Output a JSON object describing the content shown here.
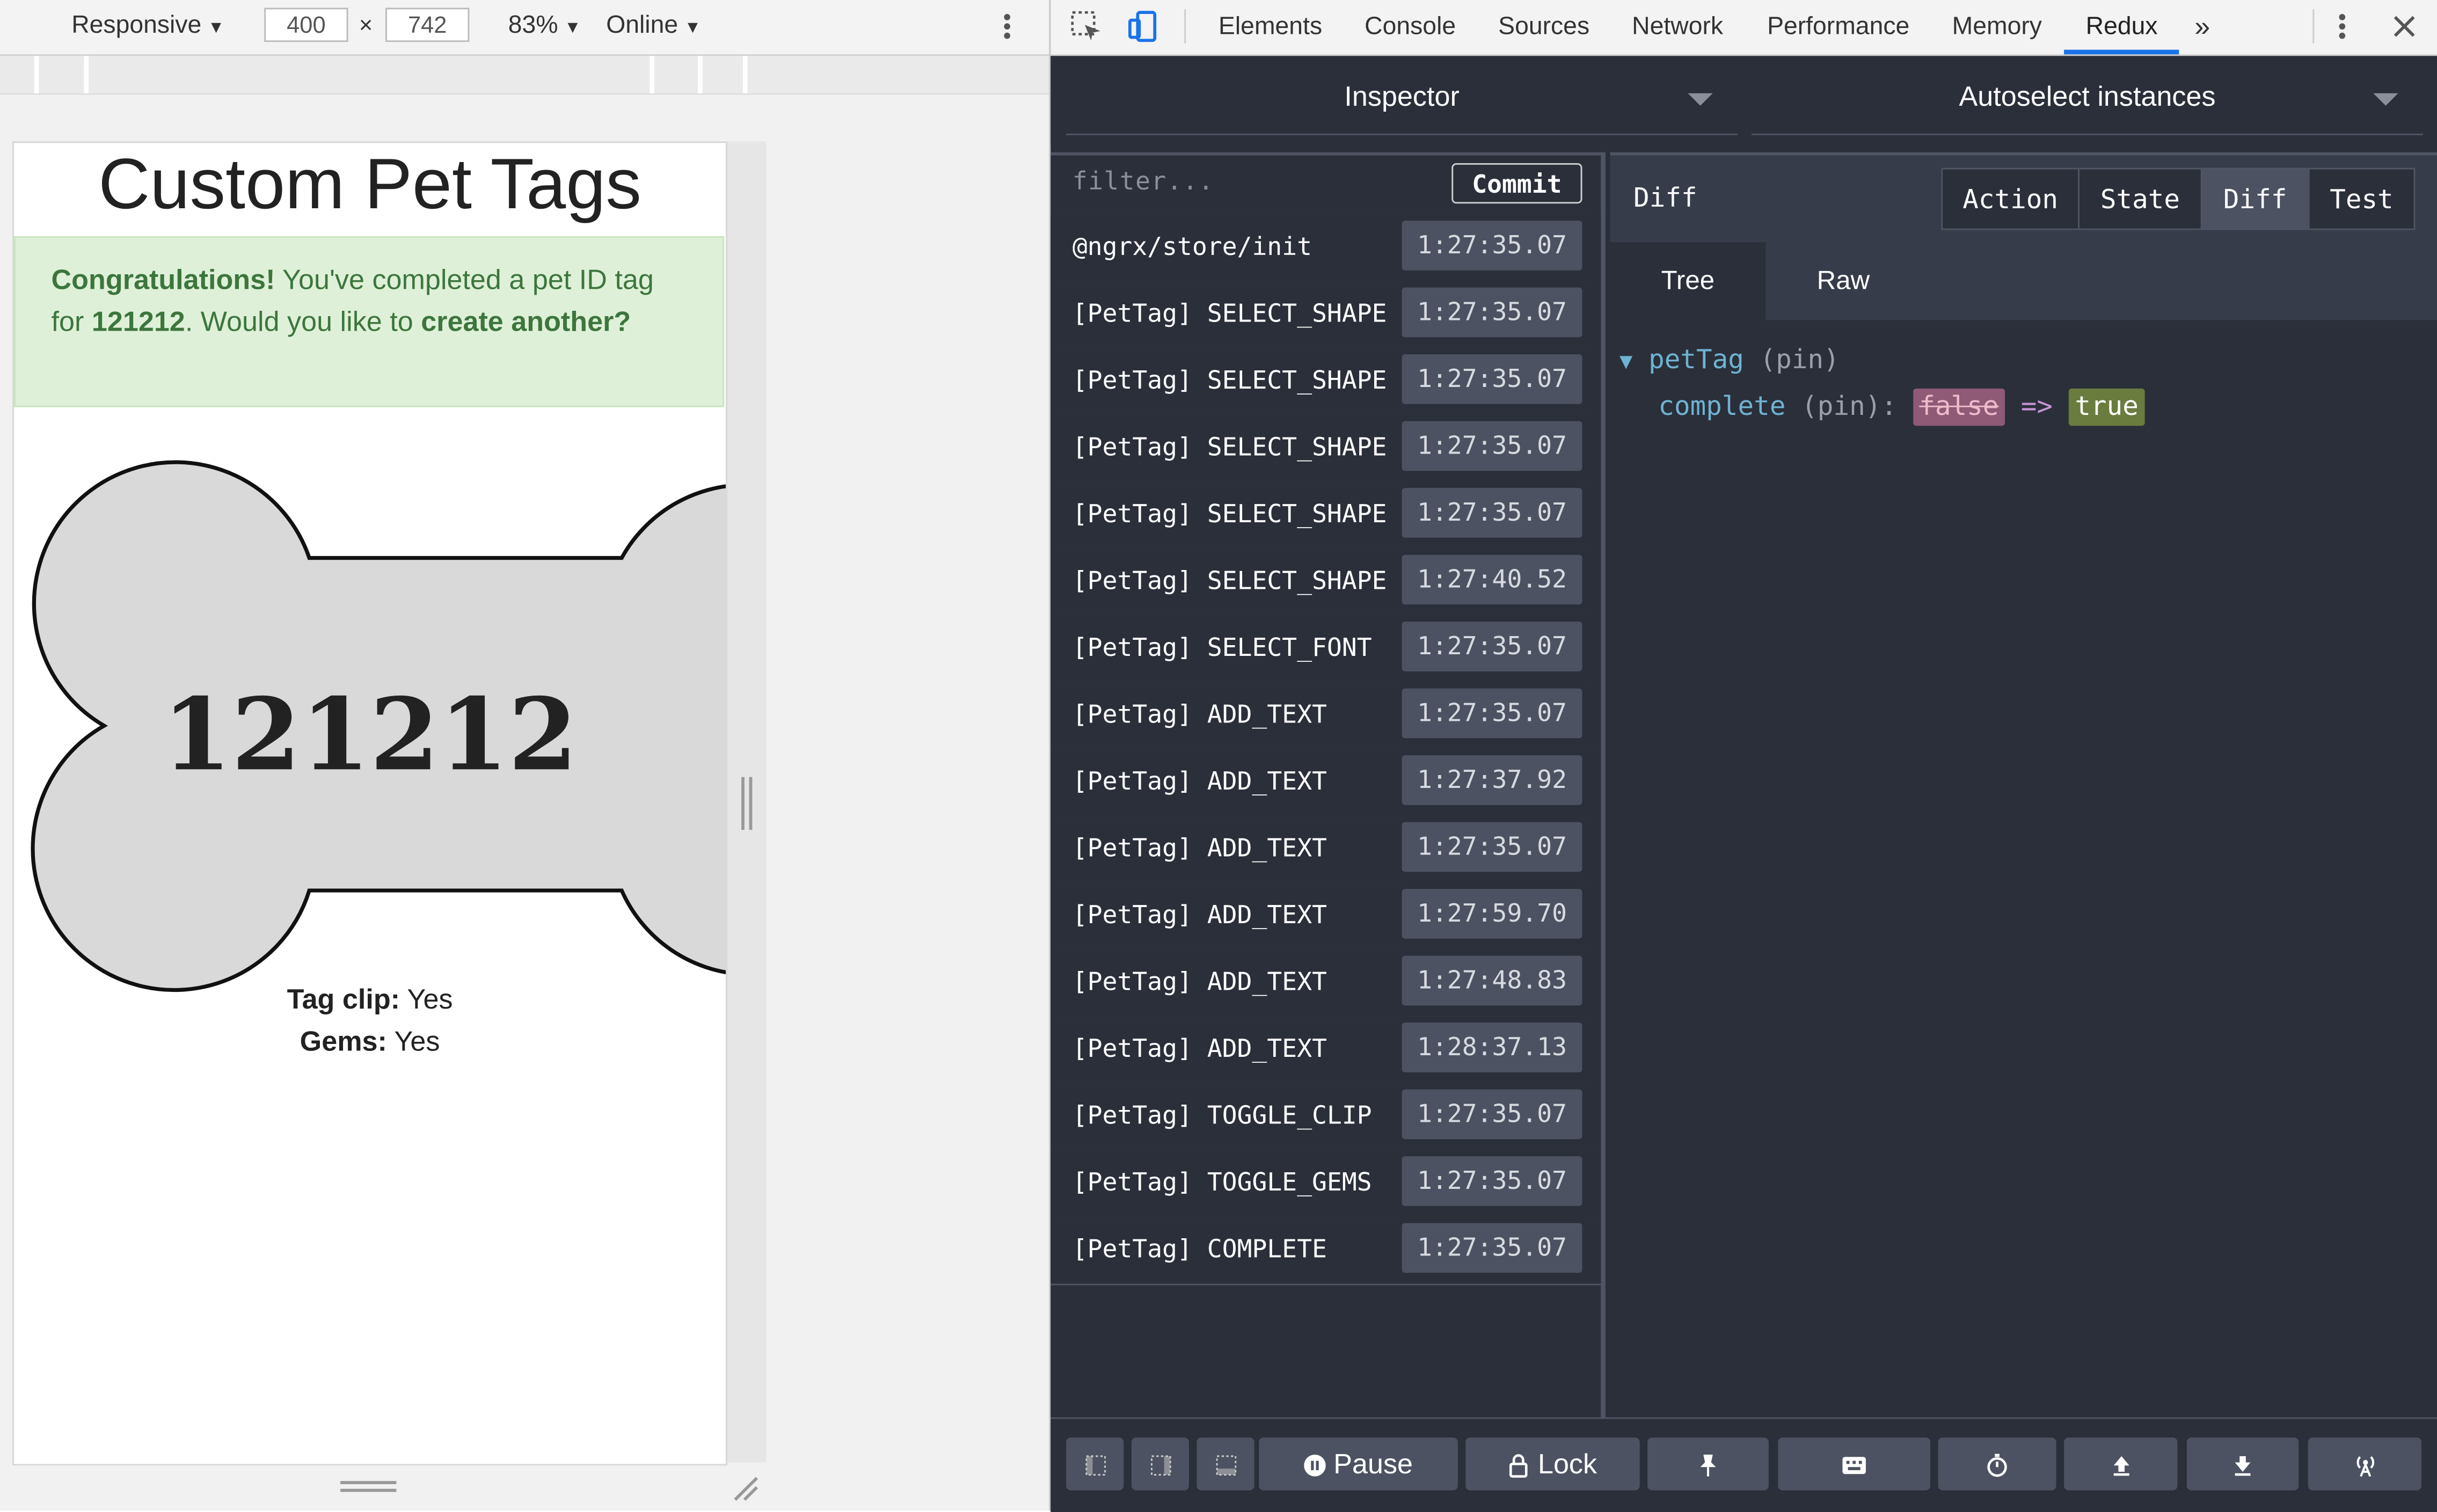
{
  "device_toolbar": {
    "mode": "Responsive",
    "width": "400",
    "times": "×",
    "height": "742",
    "zoom": "83%",
    "network": "Online"
  },
  "page": {
    "title": "Custom Pet Tags",
    "alert": {
      "strong": "Congratulations!",
      "text1": " You've completed a pet ID tag for ",
      "tag_id": "121212",
      "text2": ". Would you like to ",
      "link": "create another?"
    },
    "tag_text": "121212",
    "clip_label": "Tag clip:",
    "clip_value": " Yes",
    "gems_label": "Gems:",
    "gems_value": " Yes"
  },
  "devtools": {
    "tabs": [
      "Elements",
      "Console",
      "Sources",
      "Network",
      "Performance",
      "Memory",
      "Redux"
    ],
    "active_tab": "Redux",
    "more": "»",
    "inspector_label": "Inspector",
    "instances_label": "Autoselect instances",
    "filter_placeholder": "filter...",
    "commit_label": "Commit",
    "actions": [
      {
        "name": "@ngrx/store/init",
        "time": "1:27:35.07"
      },
      {
        "name": "[PetTag] SELECT_SHAPE",
        "time": "1:27:35.07"
      },
      {
        "name": "[PetTag] SELECT_SHAPE",
        "time": "1:27:35.07"
      },
      {
        "name": "[PetTag] SELECT_SHAPE",
        "time": "1:27:35.07"
      },
      {
        "name": "[PetTag] SELECT_SHAPE",
        "time": "1:27:35.07"
      },
      {
        "name": "[PetTag] SELECT_SHAPE",
        "time": "1:27:40.52"
      },
      {
        "name": "[PetTag] SELECT_FONT",
        "time": "1:27:35.07"
      },
      {
        "name": "[PetTag] ADD_TEXT",
        "time": "1:27:35.07"
      },
      {
        "name": "[PetTag] ADD_TEXT",
        "time": "1:27:37.92"
      },
      {
        "name": "[PetTag] ADD_TEXT",
        "time": "1:27:35.07"
      },
      {
        "name": "[PetTag] ADD_TEXT",
        "time": "1:27:59.70"
      },
      {
        "name": "[PetTag] ADD_TEXT",
        "time": "1:27:48.83"
      },
      {
        "name": "[PetTag] ADD_TEXT",
        "time": "1:28:37.13"
      },
      {
        "name": "[PetTag] TOGGLE_CLIP",
        "time": "1:27:35.07"
      },
      {
        "name": "[PetTag] TOGGLE_GEMS",
        "time": "1:27:35.07"
      },
      {
        "name": "[PetTag] COMPLETE",
        "time": "1:27:35.07"
      }
    ],
    "detail_title": "Diff",
    "detail_buttons": [
      "Action",
      "State",
      "Diff",
      "Test"
    ],
    "detail_active": "Diff",
    "view_tabs": [
      "Tree",
      "Raw"
    ],
    "view_active": "Tree",
    "diff": {
      "root_key": "petTag",
      "root_note": "(pin)",
      "child_key": "complete",
      "child_note": "(pin):",
      "old_value": "false",
      "arrow": "=>",
      "new_value": "true"
    },
    "bottom": {
      "pause_label": "Pause",
      "lock_label": "Lock"
    }
  }
}
